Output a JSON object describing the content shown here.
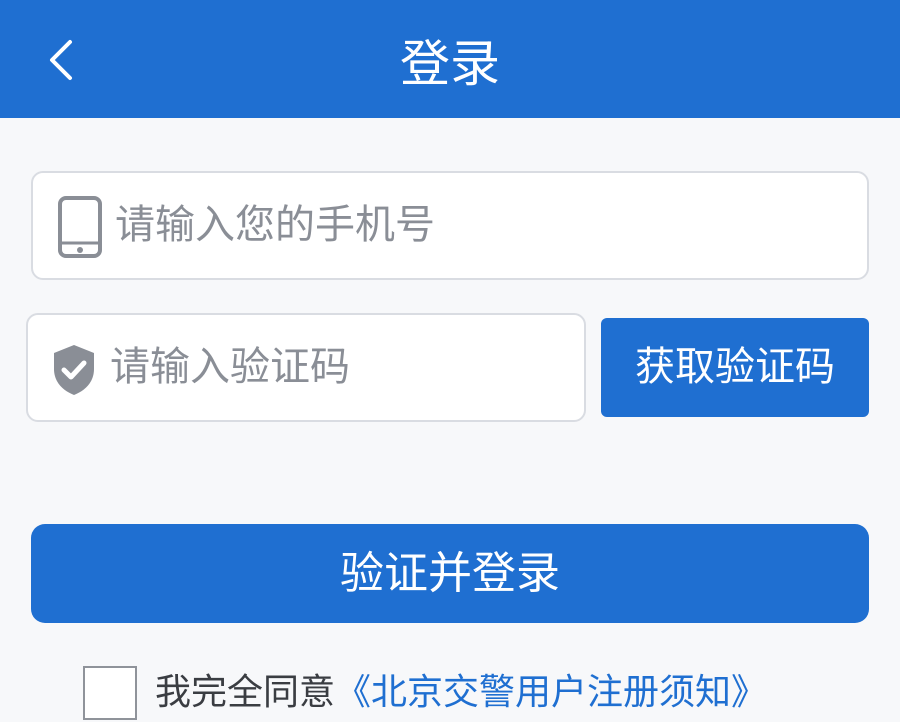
{
  "header": {
    "title": "登录"
  },
  "phone": {
    "placeholder": "请输入您的手机号"
  },
  "code": {
    "placeholder": "请输入验证码"
  },
  "buttons": {
    "get_code": "获取验证码",
    "login": "验证并登录"
  },
  "agreement": {
    "prefix": "我完全同意",
    "link": "《北京交警用户注册须知》",
    "checked": false
  },
  "colors": {
    "primary": "#1f6fd1",
    "background": "#f7f8fa",
    "placeholder": "#8a8e96"
  },
  "icons": {
    "back": "chevron-left-icon",
    "phone": "phone-icon",
    "code": "shield-check-icon"
  }
}
